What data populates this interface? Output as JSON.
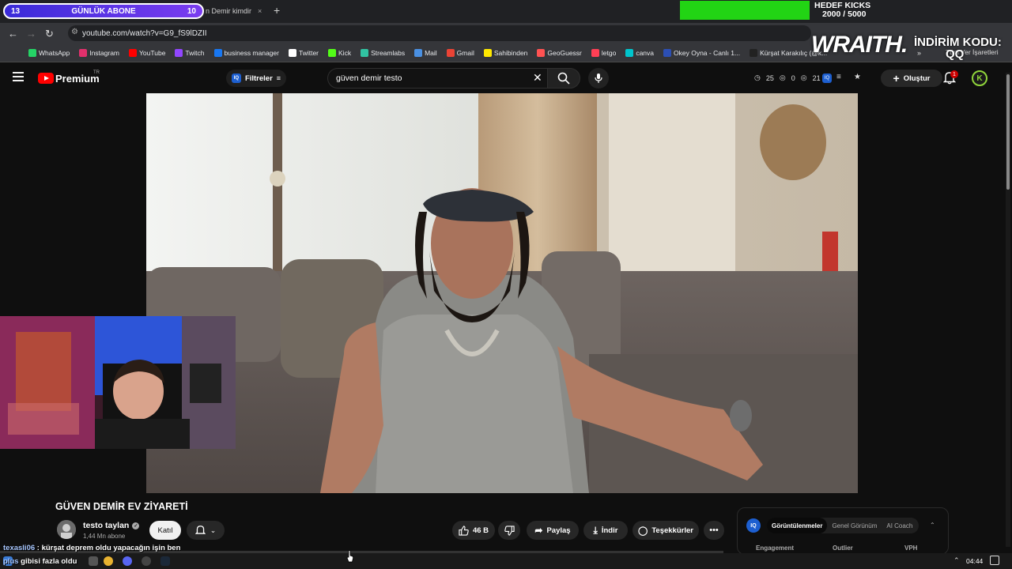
{
  "subscriber_goal": {
    "left_count": "13",
    "label": "GÜNLÜK ABONE",
    "right_count": "10"
  },
  "tab": {
    "title": "n Demir kimdir",
    "close": "×"
  },
  "new_tab": "+",
  "kicks_goal": {
    "title": "HEDEF KICKS",
    "progress": "2000 / 5000",
    "fraction": 0.4,
    "color": "#22d414"
  },
  "address_bar": {
    "url": "youtube.com/watch?v=G9_fS9lDZII"
  },
  "bookmarks": [
    {
      "label": "WhatsApp",
      "color": "#25d366"
    },
    {
      "label": "Instagram",
      "color": "#e1306c"
    },
    {
      "label": "YouTube",
      "color": "#ff0000"
    },
    {
      "label": "Twitch",
      "color": "#9146ff"
    },
    {
      "label": "business manager",
      "color": "#1877f2"
    },
    {
      "label": "Twitter",
      "color": "#ffffff"
    },
    {
      "label": "Kick",
      "color": "#53fc18"
    },
    {
      "label": "Streamlabs",
      "color": "#31c3a2"
    },
    {
      "label": "Mail",
      "color": "#4a90e2"
    },
    {
      "label": "Gmail",
      "color": "#ea4335"
    },
    {
      "label": "Sahibinden",
      "color": "#ffe800"
    },
    {
      "label": "GeoGuessr",
      "color": "#ff5252"
    },
    {
      "label": "letgo",
      "color": "#ff3f55"
    },
    {
      "label": "canva",
      "color": "#00c4cc"
    },
    {
      "label": "Okey Oyna - Canlı 1...",
      "color": "#2c4fb4"
    },
    {
      "label": "Kürşat Karakılıç (@k...",
      "color": "#222222"
    }
  ],
  "bookmarks_other": "Tüm Yer İşaretleri",
  "sponsor": {
    "brand": "WRAITH.",
    "code_label": "İNDİRİM KODU:",
    "code": "QQ"
  },
  "youtube": {
    "brand": "Premium",
    "region": "TR",
    "filter_label": "Filtreler",
    "search_value": "güven demir testo",
    "stats": [
      "25",
      "0",
      "21"
    ],
    "create_label": "Oluştur",
    "notif_count": "1",
    "avatar_letter": "K"
  },
  "video": {
    "title": "GÜVEN DEMİR EV ZİYARETİ",
    "channel": "testo taylan",
    "subscribers": "1,44 Mn abone",
    "join_label": "Katıl",
    "likes": "46 B",
    "share_label": "Paylaş",
    "download_label": "İndir",
    "thanks_label": "Teşekkürler",
    "more": "•••"
  },
  "vidiq": {
    "logo": "IQ",
    "tabs": [
      "Görüntülenmeler",
      "Genel Görünüm",
      "AI Coach"
    ],
    "columns": [
      "Engagement",
      "Outlier",
      "VPH"
    ]
  },
  "chat": [
    {
      "user": "texasli06",
      "message": " : kürşat deprem oldu yapacağın işin ben"
    },
    {
      "user": "plus",
      "message": " gibisi fazla oldu"
    }
  ],
  "taskbar": {
    "time": "04:44"
  }
}
